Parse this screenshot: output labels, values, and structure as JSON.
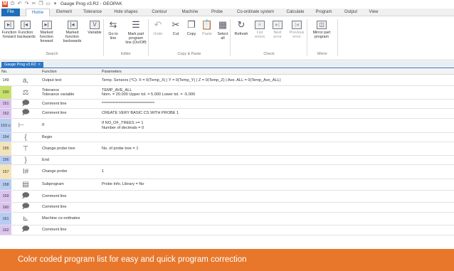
{
  "titlebar": {
    "title": "Gauge Prog v3.R2 - GEOPAK",
    "quick_access": [
      {
        "icon": "logo-icon",
        "glyph": "M"
      },
      {
        "icon": "power-icon",
        "glyph": "⏻"
      },
      {
        "icon": "undo-icon",
        "glyph": "↶"
      },
      {
        "icon": "redo-icon",
        "glyph": "↷"
      },
      {
        "icon": "cut-icon",
        "glyph": "✂"
      },
      {
        "icon": "copy-icon",
        "glyph": "❐"
      },
      {
        "icon": "new-icon",
        "glyph": "▭"
      },
      {
        "icon": "dropdown-icon",
        "glyph": "▾"
      }
    ]
  },
  "tabs": [
    "File",
    "Home",
    "Element",
    "Tolerance",
    "Hole shapes",
    "Contour",
    "Machine",
    "Probe",
    "Co-ordinate system",
    "Calculate",
    "Program",
    "Output",
    "View"
  ],
  "ribbon": {
    "buttons": [
      {
        "line1": "Function",
        "line2": "forward",
        "glyph": "▸|",
        "dim": false
      },
      {
        "line1": "Function",
        "line2": "backwards",
        "glyph": "|◂",
        "dim": false
      },
      {
        "line1": "Marked function",
        "line2": "forward",
        "glyph": "▸|",
        "dim": false
      },
      {
        "line1": "Marked function",
        "line2": "backwards",
        "glyph": "|◂",
        "dim": false
      },
      {
        "line1": "Variable",
        "line2": "",
        "glyph": "V",
        "dim": false
      },
      {
        "line1": "Go to",
        "line2": "line",
        "glyph": "⇆",
        "dim": false
      },
      {
        "line1": "Mark part program",
        "line2": "line (On/Off)",
        "glyph": "☰",
        "dim": false
      },
      {
        "line1": "Undo",
        "line2": "",
        "glyph": "↶",
        "dim": true
      },
      {
        "line1": "Cut",
        "line2": "",
        "glyph": "✂",
        "dim": false
      },
      {
        "line1": "Copy",
        "line2": "",
        "glyph": "❐",
        "dim": false
      },
      {
        "line1": "Paste",
        "line2": "",
        "glyph": "📋",
        "dim": true
      },
      {
        "line1": "Select",
        "line2": "all",
        "glyph": "▦",
        "dim": false
      },
      {
        "line1": "Refresh",
        "line2": "",
        "glyph": "↻",
        "dim": false
      },
      {
        "line1": "List",
        "line2": "errors",
        "glyph": "≡",
        "dim": true
      },
      {
        "line1": "Next",
        "line2": "error",
        "glyph": "▸|",
        "dim": true
      },
      {
        "line1": "Previous",
        "line2": "error",
        "glyph": "|◂",
        "dim": true
      },
      {
        "line1": "Mirror part",
        "line2": "program",
        "glyph": "◫",
        "dim": false
      }
    ],
    "groups": [
      "Search",
      "Editor",
      "Copy & Paste",
      "Check",
      "Mirror"
    ]
  },
  "document_tab": {
    "label": "Gauge Prog v3.R2",
    "close": "×"
  },
  "table": {
    "headers": {
      "no": "No.",
      "function": "Function",
      "parameters": "Parameters"
    },
    "rows": [
      {
        "no": "149",
        "color": "#ffffff",
        "icon": "output-text-icon",
        "glyph": "a,",
        "function": [
          "Output text"
        ],
        "params": [
          "Temp. Sensors (°C): X = 0(Temp_X) | Y = 0(Temp_Y) | Z = 0(Temp_Z) | Ave. ALL = 0(Temp_Ave_ALL)"
        ]
      },
      {
        "no": "150",
        "color": "#c6e06a",
        "icon": "tolerance-variable-icon",
        "glyph": "⚖",
        "function": [
          "Tolerance",
          "Tolerance variable"
        ],
        "params": [
          "TEMP_AVE_ALL",
          "Nom. = 20.000  Upper tol. = 5.000  Lower tol. = -5.000"
        ]
      },
      {
        "no": "151",
        "color": "#dcc4f0",
        "icon": "comment-icon",
        "glyph": "🗩",
        "function": [
          "Comment line"
        ],
        "params": [
          "**********************************"
        ]
      },
      {
        "no": "152",
        "color": "#dcc4f0",
        "icon": "comment-icon",
        "glyph": "🗩",
        "function": [
          "Comment line"
        ],
        "params": [
          "CREATE VERY BASIC CS WITH PROBE 1"
        ]
      },
      {
        "no": "153",
        "color": "#b8ccf2",
        "icon": "if-branch-icon",
        "glyph": "⊢",
        "function": [
          "If"
        ],
        "params": [
          "If NO_OF_TREES >= 1",
          "Number of decimals = 0"
        ],
        "expand": true
      },
      {
        "no": "154",
        "color": "#b8ccf2",
        "icon": "begin-brace-icon",
        "glyph": "{",
        "function": [
          "Begin"
        ],
        "params": [
          ""
        ]
      },
      {
        "no": "155",
        "color": "#f2e4b8",
        "icon": "change-probe-tree-icon",
        "glyph": "⊤",
        "function": [
          "Change probe tree"
        ],
        "params": [
          "No. of probe tree = 1"
        ]
      },
      {
        "no": "156",
        "color": "#b8ccf2",
        "icon": "end-brace-icon",
        "glyph": "}",
        "function": [
          "End"
        ],
        "params": [
          ""
        ]
      },
      {
        "no": "157",
        "color": "#f2e4b8",
        "icon": "change-probe-icon",
        "glyph": "I#",
        "function": [
          "Change probe"
        ],
        "params": [
          "1"
        ]
      },
      {
        "no": "158",
        "color": "#b8ccf2",
        "icon": "subprogram-icon",
        "glyph": "▤",
        "function": [
          "Subprogram"
        ],
        "params": [
          "Probe Info. Library = No"
        ]
      },
      {
        "no": "159",
        "color": "#dcc4f0",
        "icon": "comment-icon",
        "glyph": "🗩",
        "function": [
          "Comment line"
        ],
        "params": [
          ""
        ]
      },
      {
        "no": "160",
        "color": "#dcc4f0",
        "icon": "comment-icon",
        "glyph": "🗩",
        "function": [
          "Comment line"
        ],
        "params": [
          ""
        ]
      },
      {
        "no": "161",
        "color": "#b8ccf2",
        "icon": "machine-coordinates-icon",
        "glyph": "⊾",
        "function": [
          "Machine co-ordinates"
        ],
        "params": [
          ""
        ]
      },
      {
        "no": "162",
        "color": "#dcc4f0",
        "icon": "comment-icon",
        "glyph": "🗩",
        "function": [
          "Comment line"
        ],
        "params": [
          ""
        ]
      }
    ]
  },
  "caption": "Color coded program list for easy and quick program correction"
}
